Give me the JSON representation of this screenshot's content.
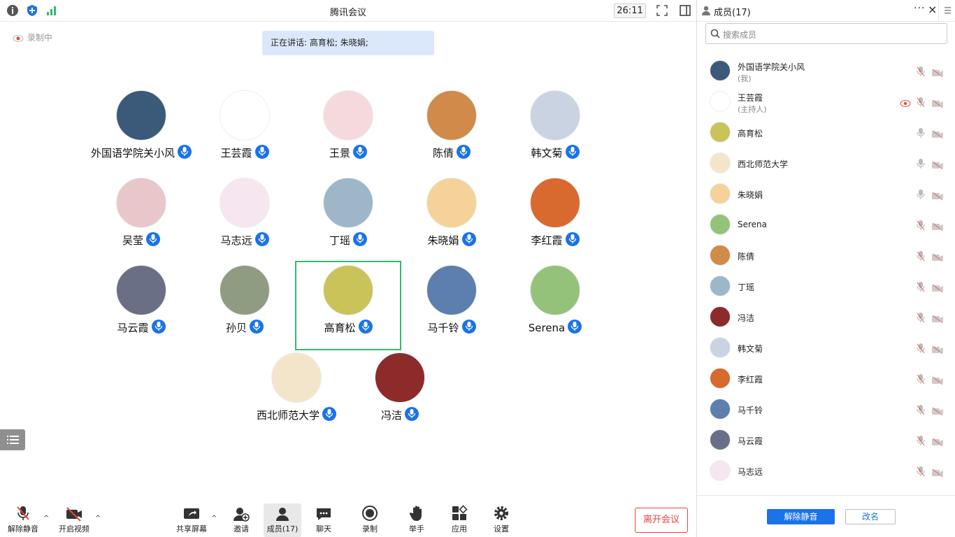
{
  "window": {
    "title": "腾讯会议",
    "timer": "26:11"
  },
  "recording": {
    "label": "录制中"
  },
  "speaking": {
    "text": "正在讲话: 高育松; 朱晓娟;"
  },
  "tiles": [
    {
      "name": "外国语学院关小风",
      "color": "#3b5a7a"
    },
    {
      "name": "王芸霞",
      "color": "#ffffff"
    },
    {
      "name": "王景",
      "color": "#f6d9dc"
    },
    {
      "name": "陈倩",
      "color": "#d08a4a"
    },
    {
      "name": "韩文菊",
      "color": "#c9d3e2"
    },
    {
      "name": "吴莹",
      "color": "#e9c6c9"
    },
    {
      "name": "马志远",
      "color": "#f6e6ef"
    },
    {
      "name": "丁瑶",
      "color": "#9db7c9"
    },
    {
      "name": "朱晓娟",
      "color": "#f4d29a"
    },
    {
      "name": "李红霞",
      "color": "#d8692f"
    },
    {
      "name": "马云霞",
      "color": "#6b6f86"
    },
    {
      "name": "孙贝",
      "color": "#8f9c82"
    },
    {
      "name": "高育松",
      "color": "#c9c35a"
    },
    {
      "name": "马千铃",
      "color": "#5c7fb0"
    },
    {
      "name": "Serena",
      "color": "#94c27a"
    },
    {
      "name": "西北师范大学",
      "color": "#f2e5c9"
    },
    {
      "name": "冯洁",
      "color": "#8d2a2a"
    }
  ],
  "toolbar": {
    "unmute": "解除静音",
    "start_video": "开启视频",
    "share": "共享屏幕",
    "invite": "邀请",
    "members": "成员(17)",
    "chat": "聊天",
    "record": "录制",
    "raise_hand": "举手",
    "apps": "应用",
    "settings": "设置",
    "leave": "离开会议"
  },
  "panel": {
    "title": "成员(17)",
    "search_placeholder": "搜索成员",
    "members": [
      {
        "name": "外国语学院关小风",
        "sub": "(我)",
        "color": "#3b5a7a",
        "mic": "muted"
      },
      {
        "name": "王芸霞",
        "sub": "(主持人)",
        "color": "#ffffff",
        "mic": "muted",
        "eye": true
      },
      {
        "name": "高育松",
        "sub": "",
        "color": "#c9c35a",
        "mic": "on"
      },
      {
        "name": "西北师范大学",
        "sub": "",
        "color": "#f2e5c9",
        "mic": "on"
      },
      {
        "name": "朱晓娟",
        "sub": "",
        "color": "#f4d29a",
        "mic": "on"
      },
      {
        "name": "Serena",
        "sub": "",
        "color": "#94c27a",
        "mic": "muted"
      },
      {
        "name": "陈倩",
        "sub": "",
        "color": "#d08a4a",
        "mic": "muted"
      },
      {
        "name": "丁瑶",
        "sub": "",
        "color": "#9db7c9",
        "mic": "muted"
      },
      {
        "name": "冯洁",
        "sub": "",
        "color": "#8d2a2a",
        "mic": "muted"
      },
      {
        "name": "韩文菊",
        "sub": "",
        "color": "#c9d3e2",
        "mic": "muted"
      },
      {
        "name": "李红霞",
        "sub": "",
        "color": "#d8692f",
        "mic": "muted"
      },
      {
        "name": "马千铃",
        "sub": "",
        "color": "#5c7fb0",
        "mic": "muted"
      },
      {
        "name": "马云霞",
        "sub": "",
        "color": "#6b6f86",
        "mic": "muted"
      },
      {
        "name": "马志远",
        "sub": "",
        "color": "#f6e6ef",
        "mic": "muted"
      }
    ],
    "unmute_all": "解除静音",
    "rename": "改名"
  }
}
